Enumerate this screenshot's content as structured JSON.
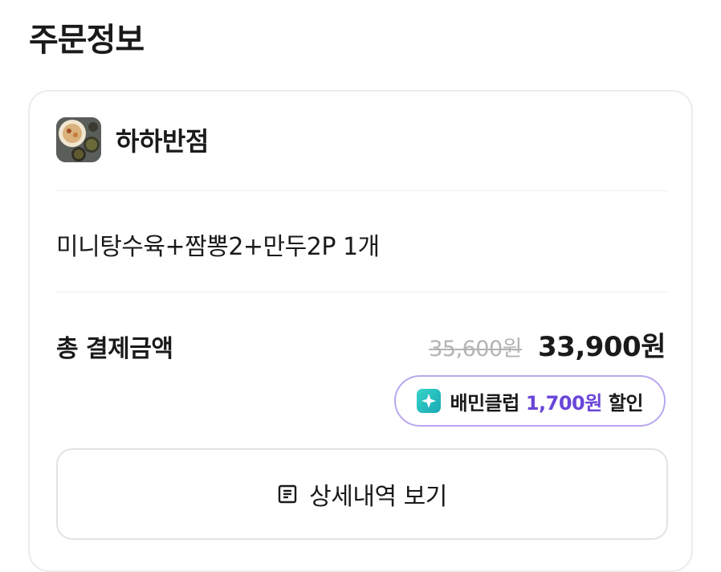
{
  "page": {
    "title": "주문정보"
  },
  "store": {
    "name": "하하반점",
    "thumbnail_icon": "food-photo-icon"
  },
  "order": {
    "menu_line": "미니탕수육+짬뽕2+만두2P 1개"
  },
  "payment": {
    "total_label": "총 결제금액",
    "original_price": "35,600원",
    "final_price": "33,900원"
  },
  "club_badge": {
    "icon": "sparkle-icon",
    "label": "배민클럽",
    "discount_amount": "1,700원",
    "discount_suffix": "할인",
    "accent_color": "#6a45d8",
    "border_color": "#b9a7ee"
  },
  "detail_button": {
    "icon": "document-list-icon",
    "label": "상세내역 보기"
  }
}
